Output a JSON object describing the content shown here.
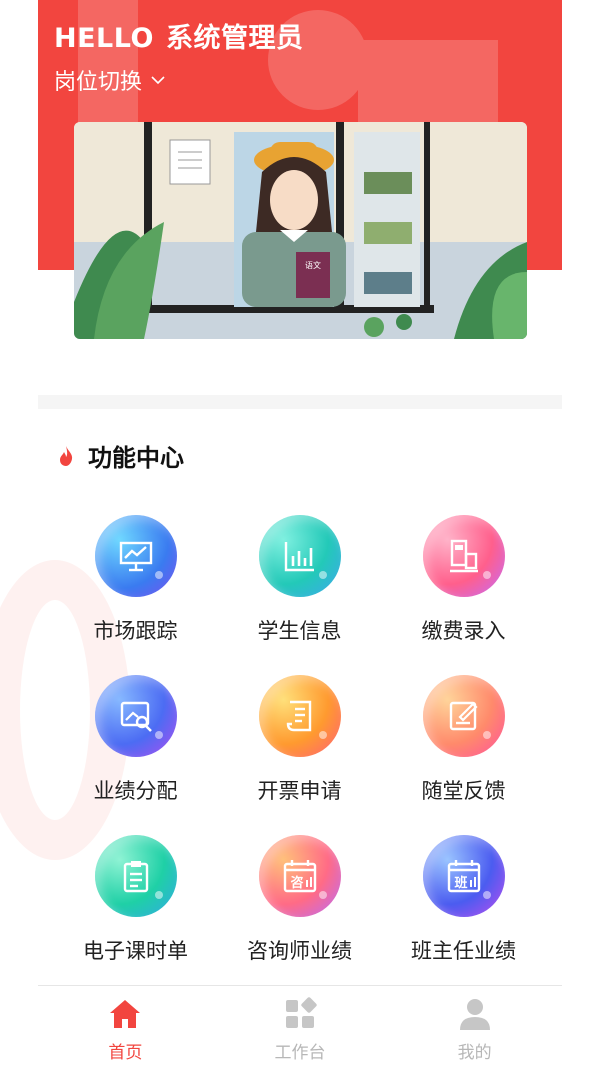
{
  "header": {
    "greeting_word": "HELLO",
    "user_role": "系统管理员",
    "switch_label": "岗位切换",
    "background_color": "#f2453f"
  },
  "banner": {
    "book_label": "语文"
  },
  "section": {
    "title": "功能中心"
  },
  "functions": [
    {
      "label": "市场跟踪",
      "icon": "presentation-chart-icon"
    },
    {
      "label": "学生信息",
      "icon": "bar-chart-icon"
    },
    {
      "label": "缴费录入",
      "icon": "pos-terminal-icon"
    },
    {
      "label": "业绩分配",
      "icon": "image-search-icon"
    },
    {
      "label": "开票申请",
      "icon": "receipt-icon"
    },
    {
      "label": "随堂反馈",
      "icon": "edit-note-icon"
    },
    {
      "label": "电子课时单",
      "icon": "clipboard-list-icon"
    },
    {
      "label": "咨询师业绩",
      "icon": "calendar-consult-icon",
      "glyph": "咨"
    },
    {
      "label": "班主任业绩",
      "icon": "calendar-class-icon",
      "glyph": "班"
    }
  ],
  "tabbar": {
    "items": [
      {
        "label": "首页",
        "icon": "home-icon",
        "active": true
      },
      {
        "label": "工作台",
        "icon": "workbench-icon",
        "active": false
      },
      {
        "label": "我的",
        "icon": "user-icon",
        "active": false
      }
    ],
    "active_color": "#f2453f",
    "inactive_color": "#b7b7b7"
  }
}
